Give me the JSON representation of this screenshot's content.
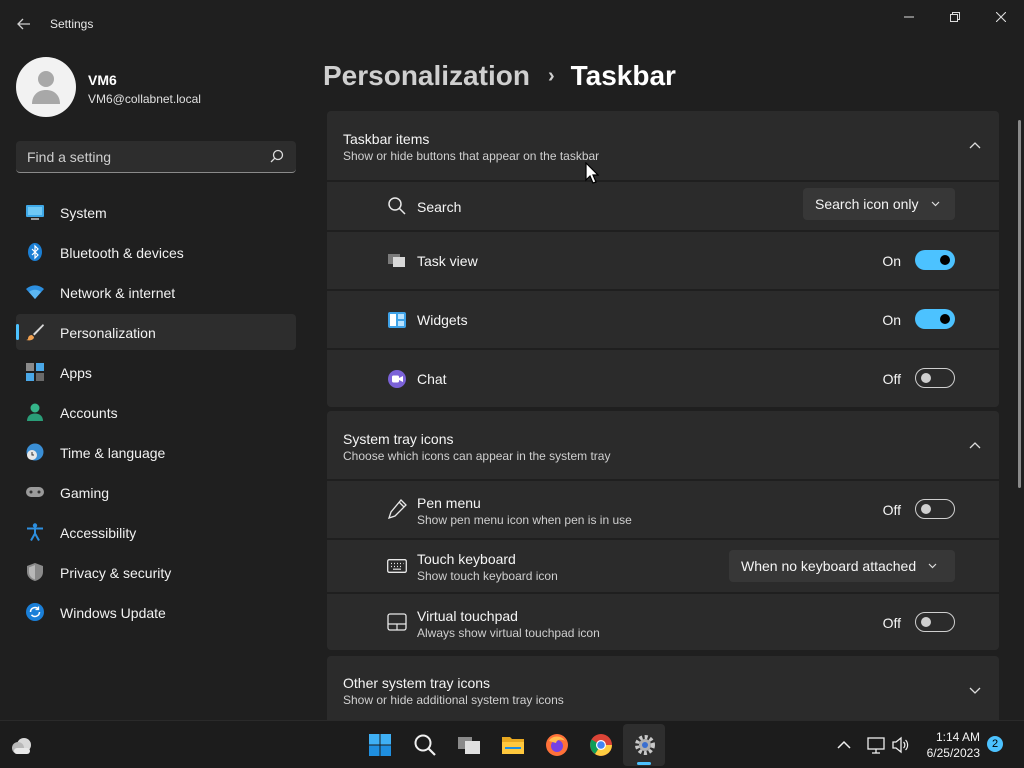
{
  "window": {
    "title": "Settings"
  },
  "profile": {
    "name": "VM6",
    "email": "VM6@collabnet.local"
  },
  "search": {
    "placeholder": "Find a setting"
  },
  "sidebar": {
    "items": [
      {
        "label": "System",
        "icon": "system-icon"
      },
      {
        "label": "Bluetooth & devices",
        "icon": "bluetooth-icon"
      },
      {
        "label": "Network & internet",
        "icon": "wifi-icon"
      },
      {
        "label": "Personalization",
        "icon": "brush-icon",
        "active": true
      },
      {
        "label": "Apps",
        "icon": "apps-icon"
      },
      {
        "label": "Accounts",
        "icon": "accounts-icon"
      },
      {
        "label": "Time & language",
        "icon": "time-language-icon"
      },
      {
        "label": "Gaming",
        "icon": "gamepad-icon"
      },
      {
        "label": "Accessibility",
        "icon": "accessibility-icon"
      },
      {
        "label": "Privacy & security",
        "icon": "shield-icon"
      },
      {
        "label": "Windows Update",
        "icon": "update-icon"
      }
    ]
  },
  "breadcrumb": {
    "parent": "Personalization",
    "separator": "›",
    "current": "Taskbar"
  },
  "taskbar_items": {
    "title": "Taskbar items",
    "subtitle": "Show or hide buttons that appear on the taskbar",
    "search": {
      "label": "Search",
      "value": "Search icon only"
    },
    "task_view": {
      "label": "Task view",
      "state": "On"
    },
    "widgets": {
      "label": "Widgets",
      "state": "On"
    },
    "chat": {
      "label": "Chat",
      "state": "Off"
    }
  },
  "system_tray": {
    "title": "System tray icons",
    "subtitle": "Choose which icons can appear in the system tray",
    "pen_menu": {
      "label": "Pen menu",
      "sub": "Show pen menu icon when pen is in use",
      "state": "Off"
    },
    "touch_keyboard": {
      "label": "Touch keyboard",
      "sub": "Show touch keyboard icon",
      "value": "When no keyboard attached"
    },
    "virtual_touchpad": {
      "label": "Virtual touchpad",
      "sub": "Always show virtual touchpad icon",
      "state": "Off"
    }
  },
  "other_tray": {
    "title": "Other system tray icons",
    "subtitle": "Show or hide additional system tray icons"
  },
  "clock": {
    "time": "1:14 AM",
    "date": "6/25/2023"
  },
  "notifications": {
    "count": "2"
  },
  "colors": {
    "accent": "#4cc2ff",
    "background": "#1f1f1f",
    "card": "#2b2b2b"
  }
}
